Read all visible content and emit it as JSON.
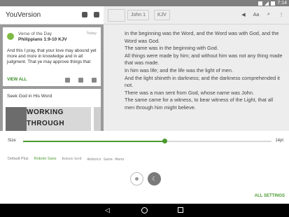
{
  "status_bar": {
    "time": "7:14"
  },
  "left_panel": {
    "brand": "YouVersion",
    "votd": {
      "label": "Verse of the Day",
      "reference": "Philippians 1:9-10 KJV",
      "date": "Today",
      "text": "And this I pray, that your love may abound yet more and more in knowledge and in all judgment. That ye may approve things that",
      "view_all": "VIEW ALL"
    },
    "plan": {
      "title": "Seek God in His Word",
      "image_line1": "WORKING",
      "image_line2": "THROUGH"
    }
  },
  "reader": {
    "book": "John 1",
    "version": "KJV",
    "font_button": "Aa",
    "verses": [
      "In the beginning was the Word, and the Word was with God, and the Word was God.",
      "The same was in the beginning with God.",
      "All things were made by him; and without him was not any thing made that was made.",
      "In him was life; and the life was the light of men.",
      "And the light shineth in darkness; and the darkness comprehended it not.",
      "There was a man sent from God, whose name was John.",
      "The same came for a witness, to bear witness of the Light, that all men through him might believe."
    ]
  },
  "settings": {
    "size_label": "Size",
    "size_value": "14pt",
    "size_fraction": 0.57,
    "fonts": [
      "Default Plus",
      "Roboto Sans",
      "Roboto Serif",
      "Roboto Sans Mono"
    ],
    "selected_font": "Roboto Sans",
    "all_settings": "ALL SETTINGS"
  },
  "colors": {
    "accent": "#4a9a2f"
  }
}
